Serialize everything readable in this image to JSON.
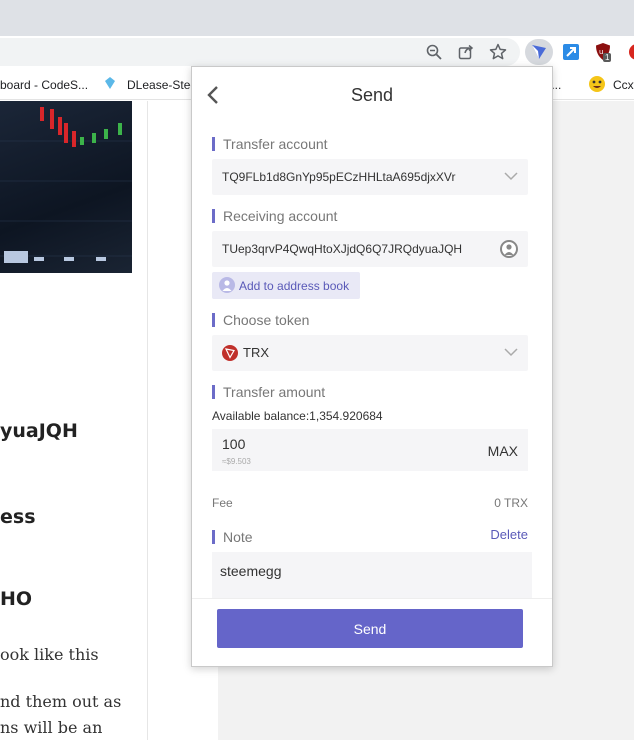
{
  "bookmarks": [
    {
      "label": "board - CodeS..."
    },
    {
      "label": "DLease-Stee"
    },
    {
      "label": "- F..."
    },
    {
      "label": "Ccxt"
    }
  ],
  "extension_badge": "1",
  "background_page": {
    "heading_1": "yuaJQH",
    "heading_2": "ess",
    "heading_3": "HO",
    "paragraph_1": "ook like this",
    "paragraph_2": "nd them out as",
    "paragraph_3": "ns will be an"
  },
  "popup": {
    "title": "Send",
    "transfer_account": {
      "label": "Transfer account",
      "value": "TQ9FLb1d8GnYp95pECzHHLtaA695djxXVr"
    },
    "receiving_account": {
      "label": "Receiving account",
      "value": "TUep3qrvP4QwqHtoXJjdQ6Q7JRQdyuaJQH"
    },
    "add_to_address_book": "Add to address book",
    "choose_token": {
      "label": "Choose token",
      "value": "TRX"
    },
    "transfer_amount": {
      "label": "Transfer amount",
      "available_balance": "Available balance:1,354.920684",
      "value": "100",
      "usd_estimate": "≈$9.503",
      "max_label": "MAX"
    },
    "fee": {
      "label": "Fee",
      "value": "0 TRX"
    },
    "note": {
      "label": "Note",
      "delete_label": "Delete",
      "value": "steemegg"
    },
    "send_button": "Send"
  },
  "colors": {
    "accent": "#6565c9",
    "label_bar": "#6c6cc8",
    "field_bg": "#f5f5f7",
    "tron_red": "#c0302b"
  }
}
